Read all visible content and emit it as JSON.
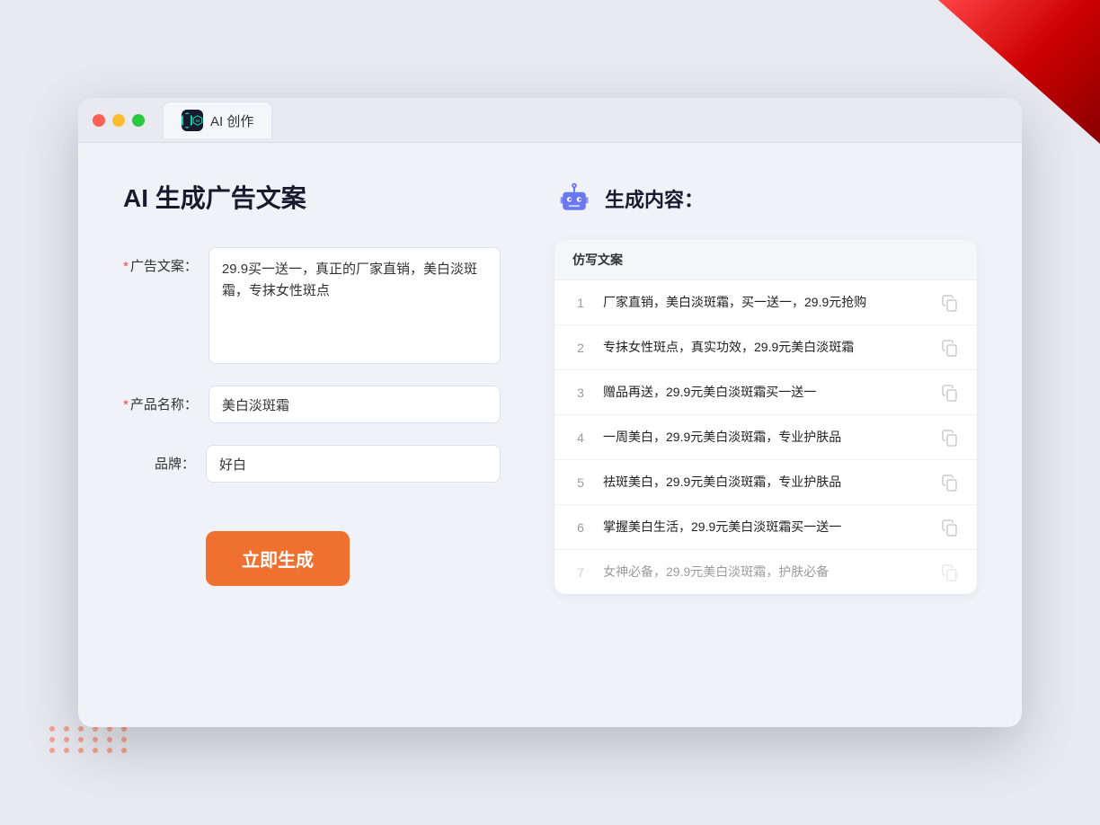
{
  "window": {
    "tab_title": "AI 创作"
  },
  "page": {
    "title": "AI 生成广告文案",
    "result_title": "生成内容："
  },
  "form": {
    "ad_copy_label": "广告文案：",
    "ad_copy_required": true,
    "ad_copy_value": "29.9买一送一，真正的厂家直销，美白淡斑霜，专抹女性斑点",
    "product_name_label": "产品名称：",
    "product_name_required": true,
    "product_name_value": "美白淡斑霜",
    "brand_label": "品牌：",
    "brand_required": false,
    "brand_value": "好白",
    "generate_button": "立即生成"
  },
  "results": {
    "column_header": "仿写文案",
    "items": [
      {
        "num": "1",
        "text": "厂家直销，美白淡斑霜，买一送一，29.9元抢购",
        "dimmed": false
      },
      {
        "num": "2",
        "text": "专抹女性斑点，真实功效，29.9元美白淡斑霜",
        "dimmed": false
      },
      {
        "num": "3",
        "text": "赠品再送，29.9元美白淡斑霜买一送一",
        "dimmed": false
      },
      {
        "num": "4",
        "text": "一周美白，29.9元美白淡斑霜，专业护肤品",
        "dimmed": false
      },
      {
        "num": "5",
        "text": "祛斑美白，29.9元美白淡斑霜，专业护肤品",
        "dimmed": false
      },
      {
        "num": "6",
        "text": "掌握美白生活，29.9元美白淡斑霜买一送一",
        "dimmed": false
      },
      {
        "num": "7",
        "text": "女神必备，29.9元美白淡斑霜，护肤必备",
        "dimmed": true
      }
    ]
  },
  "traffic_lights": {
    "red": "#ff5f57",
    "yellow": "#febc2e",
    "green": "#28c840"
  }
}
